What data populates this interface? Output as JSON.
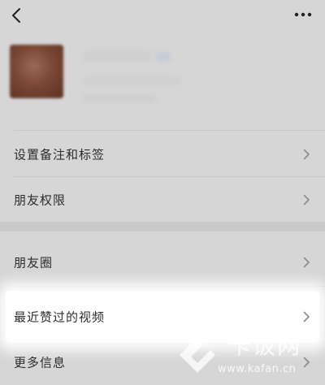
{
  "header": {
    "back_icon": "back-chevron-icon",
    "more_icon": "more-dots-icon"
  },
  "colors": {
    "background": "#d6d6d6",
    "highlight": "#ffffff",
    "text": "#2c2c2c",
    "chevron": "#8a8a8a"
  },
  "menu": {
    "items": [
      {
        "label": "设置备注和标签"
      },
      {
        "label": "朋友权限"
      },
      {
        "label": "朋友圈"
      },
      {
        "label": "最近赞过的视频"
      },
      {
        "label": "更多信息"
      }
    ]
  },
  "watermark": {
    "brand": "卡饭网",
    "url": "www.kafan.cn"
  }
}
